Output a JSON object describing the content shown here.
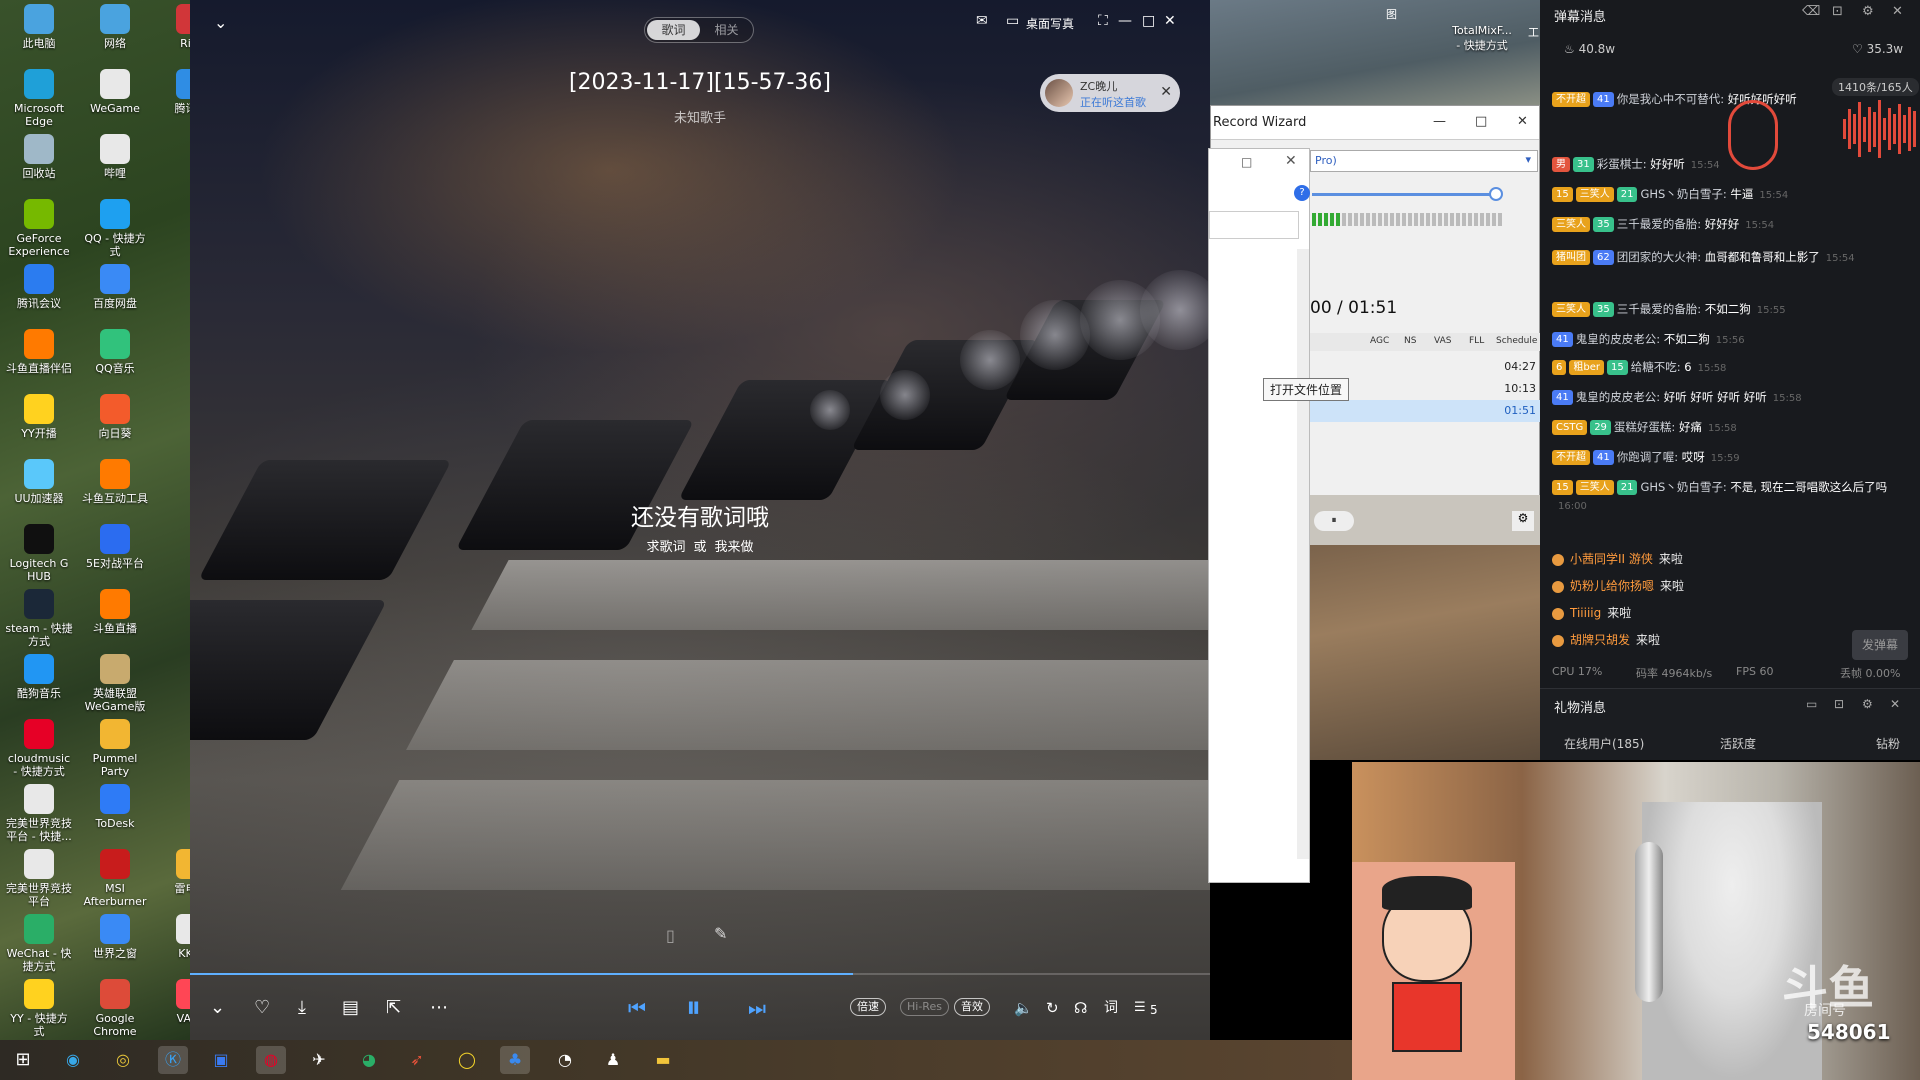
{
  "desktop": {
    "icons": [
      {
        "label": "此电脑",
        "color": "#4aa3df"
      },
      {
        "label": "网络",
        "color": "#4aa3df"
      },
      {
        "label": "Riot",
        "color": "#d13639"
      },
      {
        "label": "Microsoft\nEdge",
        "color": "#1fa0d8"
      },
      {
        "label": "WeGame",
        "color": "#e8e8e8"
      },
      {
        "label": "腾讯手",
        "color": "#2f8de4"
      },
      {
        "label": "回收站",
        "color": "#9fb8c8"
      },
      {
        "label": "哔哩",
        "color": "#e8e8e8"
      },
      {
        "label": "GeForce\nExperience",
        "color": "#76b900"
      },
      {
        "label": "QQ - 快捷方\n式",
        "color": "#1ea0f0"
      },
      {
        "label": "腾讯会议",
        "color": "#2b7cf0"
      },
      {
        "label": "百度网盘",
        "color": "#3a8af5"
      },
      {
        "label": "斗鱼直播伴侣",
        "color": "#ff7a00"
      },
      {
        "label": "QQ音乐",
        "color": "#31c27c"
      },
      {
        "label": "YY开播",
        "color": "#ffd21f"
      },
      {
        "label": "向日葵",
        "color": "#f35b2b"
      },
      {
        "label": "UU加速器",
        "color": "#5ac8fa"
      },
      {
        "label": "斗鱼互动工具",
        "color": "#ff7a00"
      },
      {
        "label": "Logitech G\nHUB",
        "color": "#101010"
      },
      {
        "label": "5E对战平台",
        "color": "#2b6cf0"
      },
      {
        "label": "steam - 快捷\n方式",
        "color": "#1b2838"
      },
      {
        "label": "斗鱼直播",
        "color": "#ff7a00"
      },
      {
        "label": "酷狗音乐",
        "color": "#2196f3"
      },
      {
        "label": "英雄联盟\nWeGame版",
        "color": "#c8aa6e"
      },
      {
        "label": "cloudmusic\n- 快捷方式",
        "color": "#e60026"
      },
      {
        "label": "Pummel\nParty",
        "color": "#f2b632"
      },
      {
        "label": "完美世界竞技\n平台 - 快捷...",
        "color": "#e8e8e8"
      },
      {
        "label": "ToDesk",
        "color": "#2e7bf6"
      },
      {
        "label": "完美世界竞技\n平台",
        "color": "#e8e8e8"
      },
      {
        "label": "MSI\nAfterburner",
        "color": "#c81c1c"
      },
      {
        "label": "雷电神",
        "color": "#f2b632"
      },
      {
        "label": "WeChat - 快\n捷方式",
        "color": "#2aae67"
      },
      {
        "label": "世界之窗",
        "color": "#3a8af5"
      },
      {
        "label": "KK对",
        "color": "#e8e8e8"
      },
      {
        "label": "YY - 快捷方\n式",
        "color": "#ffd21f"
      },
      {
        "label": "Google\nChrome",
        "color": "#dd4b39"
      },
      {
        "label": "VALO",
        "color": "#ff4655"
      }
    ]
  },
  "player": {
    "tabs": [
      "歌词",
      "相关"
    ],
    "song_title": "[2023-11-17][15-57-36]",
    "singer": "未知歌手",
    "no_lyric": "还没有歌词哦",
    "lyric_link_1": "求歌词",
    "lyric_or": "或",
    "lyric_link_2": "我来做",
    "desktop_lyric": "桌面写真",
    "listen_user": "ZC晚儿",
    "listen_status": "正在听这首歌",
    "progress_fraction": 0.65,
    "controls": {
      "speed": "倍速",
      "hires": "Hi-Res",
      "effect": "音效",
      "playlist_count": "5"
    }
  },
  "middle": {
    "record_title": "Record Wizard",
    "dropdown_value": "Pro)",
    "tooltip": "打开文件位置",
    "time": "00 / 01:51",
    "headers": [
      "AGC",
      "NS",
      "VAS",
      "FLL",
      "Schedule"
    ],
    "rows": [
      "04:27",
      "10:13",
      "01:51"
    ],
    "mixer_label": "TotalMixF...\n- 快捷方式",
    "wall_icon_label": "图",
    "wall_icon_label2": "工"
  },
  "danmaku": {
    "title": "弹幕消息",
    "likes": "40.8w",
    "hearts": "35.3w",
    "viewers": "1410条/165人",
    "messages": [
      {
        "lvl": "",
        "fan": "不开超",
        "fanlvl": "41",
        "user": "你是我心中不可替代:",
        "text": "好听好听好听",
        "time": ""
      },
      {
        "lvl": "",
        "fan": "",
        "fanlvl": "",
        "user": "",
        "text": "",
        "time": ""
      },
      {
        "lvl": "男",
        "fan": "",
        "fanlvl": "31",
        "user": "彩蛋棋士:",
        "text": "好好听",
        "time": "15:54"
      },
      {
        "lvl": "15",
        "fan": "三笑人",
        "fanlvl": "21",
        "user": "GHS丶奶白雪子:",
        "text": "牛逼",
        "time": "15:54"
      },
      {
        "lvl": "",
        "fan": "三笑人",
        "fanlvl": "35",
        "user": "三千最爱的备胎:",
        "text": "好好好",
        "time": "15:54"
      },
      {
        "lvl": "",
        "fan": "猪叫团",
        "fanlvl": "62",
        "user": "团团家的大火神:",
        "text": "血哥都和鲁哥和上影了",
        "time": "15:54"
      },
      {
        "lvl": "",
        "fan": "三笑人",
        "fanlvl": "35",
        "user": "三千最爱的备胎:",
        "text": "不如二狗",
        "time": "15:55"
      },
      {
        "lvl": "",
        "fan": "",
        "fanlvl": "41",
        "user": "鬼皇的皮皮老公:",
        "text": "不如二狗",
        "time": "15:56"
      },
      {
        "lvl": "6",
        "fan": "粗ber",
        "fanlvl": "15",
        "user": "给糖不吃:",
        "text": "6",
        "time": "15:58"
      },
      {
        "lvl": "",
        "fan": "",
        "fanlvl": "41",
        "user": "鬼皇的皮皮老公:",
        "text": "好听 好听 好听 好听",
        "time": "15:58"
      },
      {
        "lvl": "",
        "fan": "CSTG",
        "fanlvl": "29",
        "user": "蛋糕好蛋糕:",
        "text": "好痛",
        "time": "15:58"
      },
      {
        "lvl": "",
        "fan": "不开超",
        "fanlvl": "41",
        "user": "你跑调了喔:",
        "text": "哎呀",
        "time": "15:59"
      },
      {
        "lvl": "15",
        "fan": "三笑人",
        "fanlvl": "21",
        "user": "GHS丶奶白雪子:",
        "text": "不是, 现在二哥唱歌这么后了吗",
        "time": "16:00"
      }
    ],
    "entries": [
      {
        "name": "小茜同学II 游侠",
        "action": "来啦"
      },
      {
        "name": "奶粉儿给你扬嗯",
        "action": "来啦"
      },
      {
        "name": "Tiiiiig",
        "action": "来啦"
      },
      {
        "name": "胡牌只胡发",
        "action": "来啦"
      }
    ],
    "send_button": "发弹幕",
    "cpu": "CPU 17%",
    "bitrate": "码率 4964kb/s",
    "fps": "FPS 60",
    "drop": "丢帧 0.00%"
  },
  "gift": {
    "title": "礼物消息",
    "tabs": [
      "在线用户(185)",
      "活跃度",
      "钻粉"
    ]
  },
  "cam": {
    "logo": "斗鱼",
    "room_label": "房间号",
    "room_no": "548061"
  }
}
